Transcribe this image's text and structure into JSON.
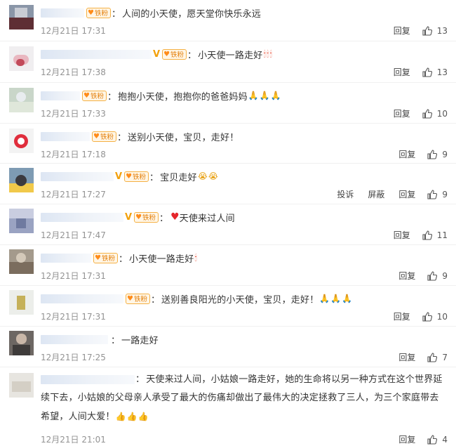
{
  "actions": {
    "reply": "回复",
    "report": "投诉",
    "block": "屏蔽"
  },
  "comments": [
    {
      "text": "人间的小天使，愿天堂你快乐永远",
      "time": "12月21日 17:31",
      "likes": "13",
      "verified": false
    },
    {
      "text": "小天使一路走好",
      "time": "12月21日 17:38",
      "likes": "13",
      "verified": true,
      "emoji": [
        "candle",
        "candle",
        "candle"
      ]
    },
    {
      "text": "抱抱小天使，抱抱你的爸爸妈妈",
      "time": "12月21日 17:33",
      "likes": "10",
      "verified": false,
      "emoji": [
        "pray",
        "pray",
        "pray"
      ]
    },
    {
      "text": "送别小天使，宝贝，走好！",
      "time": "12月21日 17:18",
      "likes": "9",
      "verified": false
    },
    {
      "text": "宝贝走好",
      "time": "12月21日 17:27",
      "likes": "9",
      "verified": true,
      "emoji": [
        "cry",
        "cry"
      ]
    },
    {
      "text": "天使来过人间",
      "time": "12月21日 17:47",
      "likes": "11",
      "verified": true
    },
    {
      "text": "小天使一路走好",
      "time": "12月21日 17:31",
      "likes": "9",
      "verified": false,
      "emoji": [
        "candle"
      ]
    },
    {
      "text": "送别善良阳光的小天使，宝贝，走好！",
      "time": "12月21日 17:31",
      "likes": "10",
      "verified": false,
      "emoji": [
        "pray",
        "pray",
        "pray"
      ]
    },
    {
      "text": "一路走好",
      "time": "12月21日 17:25",
      "likes": "7",
      "verified": false
    },
    {
      "text": "天使来过人间，小姑娘一路走好，她的生命将以另一种方式在这个世界延续下去，小姑娘的父母亲人承受了最大的伤痛却做出了最伟大的决定拯救了三人，为三个家庭带去希望，人间大爱！",
      "time": "12月21日 21:01",
      "likes": "4",
      "verified": false,
      "emoji": [
        "thumb",
        "thumb",
        "thumb"
      ]
    }
  ],
  "fan_badge": "铁粉",
  "colors": {
    "fan_border": "#f5b043",
    "fan_text": "#e4810e",
    "meta": "#939393",
    "verified": "#f2a00b"
  },
  "icons": {
    "like": "thumbs-up-icon",
    "candle": "candle-emoji-icon",
    "pray": "pray-emoji-icon",
    "cry": "crying-emoji-icon",
    "heart": "red-heart-emoji-icon",
    "thumb": "thumbs-up-emoji-icon"
  }
}
